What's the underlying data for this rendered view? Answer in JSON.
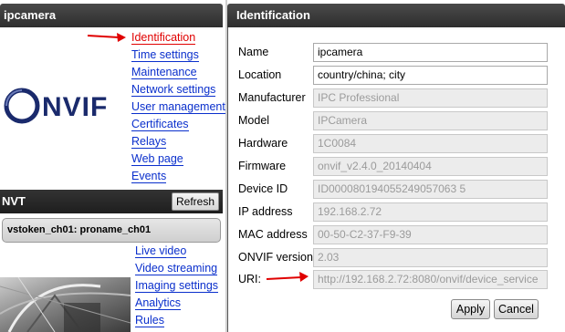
{
  "left_panel": {
    "title": "ipcamera",
    "logo_text": "ONVIF",
    "menu": [
      {
        "label": "Identification",
        "active": true
      },
      {
        "label": "Time settings",
        "active": false
      },
      {
        "label": "Maintenance",
        "active": false
      },
      {
        "label": "Network settings",
        "active": false
      },
      {
        "label": "User management",
        "active": false
      },
      {
        "label": "Certificates",
        "active": false
      },
      {
        "label": "Relays",
        "active": false
      },
      {
        "label": "Web page",
        "active": false
      },
      {
        "label": "Events",
        "active": false
      }
    ],
    "nvt": {
      "title": "NVT",
      "refresh_label": "Refresh",
      "token_label": "vstoken_ch01: proname_ch01",
      "menu": [
        {
          "label": "Live video"
        },
        {
          "label": "Video streaming"
        },
        {
          "label": "Imaging settings"
        },
        {
          "label": "Analytics"
        },
        {
          "label": "Rules"
        }
      ]
    }
  },
  "right_panel": {
    "title": "Identification",
    "fields": [
      {
        "label": "Name",
        "value": "ipcamera",
        "editable": true
      },
      {
        "label": "Location",
        "value": "country/china; city",
        "editable": true
      },
      {
        "label": "Manufacturer",
        "value": "IPC Professional",
        "editable": false
      },
      {
        "label": "Model",
        "value": "IPCamera",
        "editable": false
      },
      {
        "label": "Hardware",
        "value": "1C0084",
        "editable": false
      },
      {
        "label": "Firmware",
        "value": "onvif_v2.4.0_20140404",
        "editable": false
      },
      {
        "label": "Device ID",
        "value": "ID000080194055249057063 5",
        "editable": false
      },
      {
        "label": "IP address",
        "value": "192.168.2.72",
        "editable": false
      },
      {
        "label": "MAC address",
        "value": "00-50-C2-37-F9-39",
        "editable": false
      },
      {
        "label": "ONVIF version",
        "value": "2.03",
        "editable": false
      },
      {
        "label": "URI:",
        "value": "http://192.168.2.72:8080/onvif/device_service",
        "editable": false
      }
    ],
    "apply_label": "Apply",
    "cancel_label": "Cancel"
  },
  "colors": {
    "header_bg": "#2e2e2e",
    "link": "#0a2fcc",
    "link_active": "#e00000",
    "annotation_arrow": "#e00000"
  }
}
